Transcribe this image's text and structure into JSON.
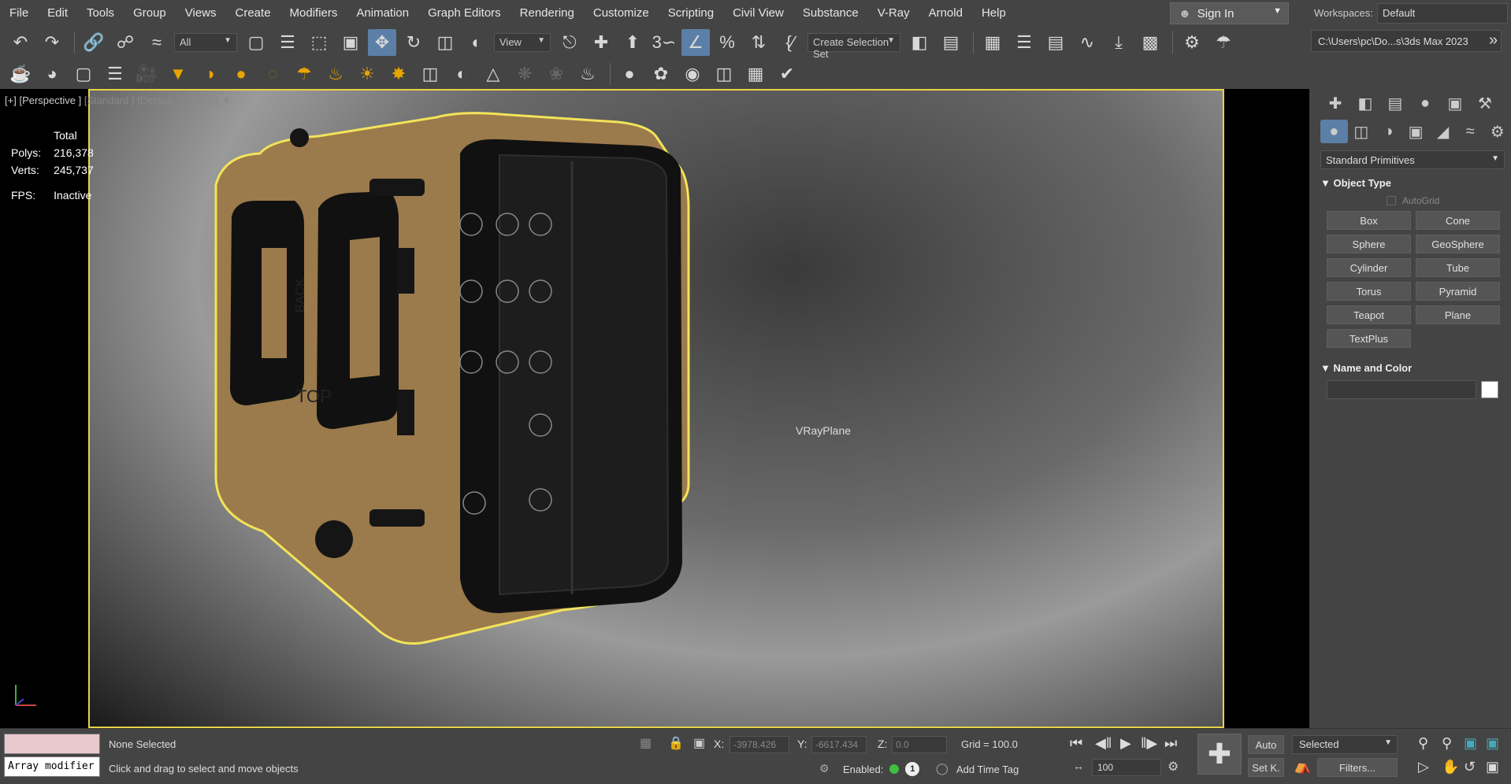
{
  "menu": [
    "File",
    "Edit",
    "Tools",
    "Group",
    "Views",
    "Create",
    "Modifiers",
    "Animation",
    "Graph Editors",
    "Rendering",
    "Customize",
    "Scripting",
    "Civil View",
    "Substance",
    "V-Ray",
    "Arnold",
    "Help"
  ],
  "sign_in": "Sign In",
  "workspaces": {
    "label": "Workspaces:",
    "value": "Default"
  },
  "toolbar": {
    "filter_value": "All",
    "ref_coord_value": "View",
    "selection_set": "Create Selection Set",
    "project_path": "C:\\Users\\pc\\Do...s\\3ds Max 2023"
  },
  "viewport": {
    "label_plus": "[+]",
    "label_view": "[Perspective ]",
    "label_standard": "[Standard ]",
    "label_shading": "[Default Shading ]",
    "stats_title": "Total",
    "polys_label": "Polys:",
    "polys_value": "216,378",
    "verts_label": "Verts:",
    "verts_value": "245,737",
    "fps_label": "FPS:",
    "fps_value": "Inactive",
    "object_label": "VRayPlane",
    "case_text_back": "BACK",
    "case_text_top": "TOP"
  },
  "command_panel": {
    "category": "Standard Primitives",
    "object_type_title": "Object Type",
    "autogrid": "AutoGrid",
    "buttons": [
      "Box",
      "Cone",
      "Sphere",
      "GeoSphere",
      "Cylinder",
      "Tube",
      "Torus",
      "Pyramid",
      "Teapot",
      "Plane",
      "TextPlus"
    ],
    "name_color_title": "Name and Color"
  },
  "status": {
    "maxscript_input": "Array modifier",
    "selection": "None Selected",
    "prompt": "Click and drag to select and move objects",
    "x_label": "X:",
    "x_value": "-3978.426",
    "y_label": "Y:",
    "y_value": "-6617.434",
    "z_label": "Z:",
    "z_value": "0.0",
    "grid": "Grid = 100.0",
    "enabled_label": "Enabled:",
    "add_time_tag": "Add Time Tag",
    "frame_value": "100",
    "auto_label": "Auto",
    "setkey_label": "Set K.",
    "selected_value": "Selected",
    "filters_label": "Filters...",
    "one_badge": "1"
  },
  "colors": {
    "selection_outline": "#e8d24a",
    "case_body": "#9b7a4b",
    "active_tool": "#5b7fa6"
  }
}
